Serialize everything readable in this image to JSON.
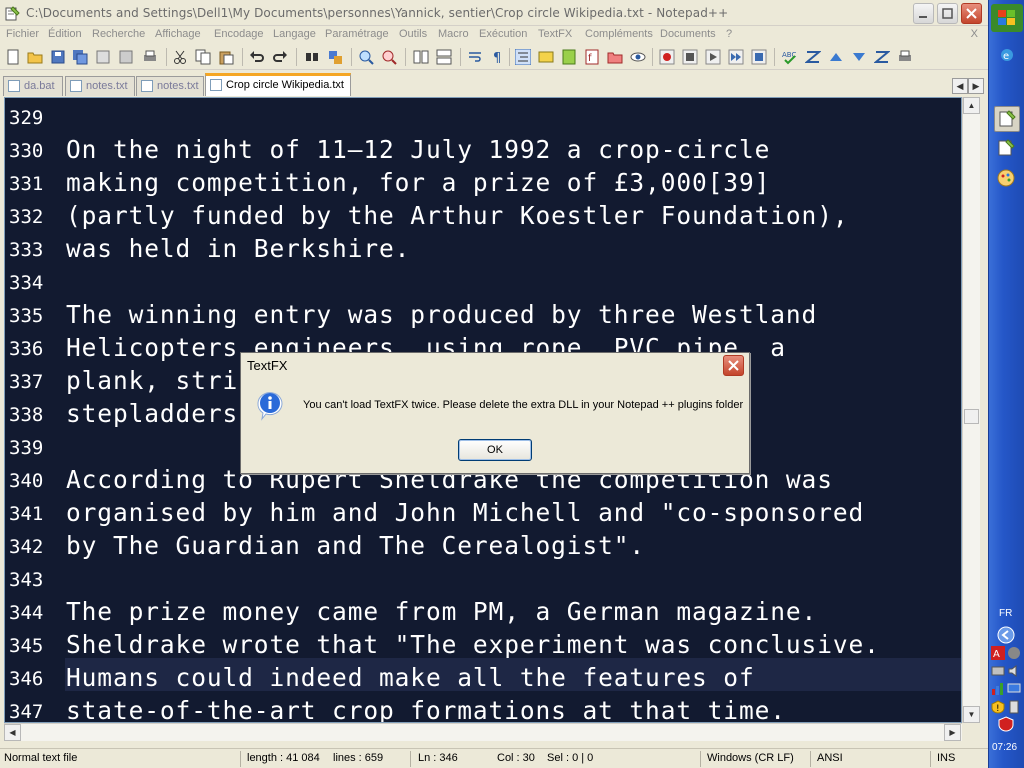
{
  "window": {
    "title": "C:\\Documents and Settings\\Dell1\\My Documents\\personnes\\Yannick, sentier\\Crop circle Wikipedia.txt - Notepad++"
  },
  "menu": {
    "items": [
      "Fichier",
      "Édition",
      "Recherche",
      "Affichage",
      "Encodage",
      "Langage",
      "Paramétrage",
      "Outils",
      "Macro",
      "Exécution",
      "TextFX",
      "Compléments",
      "Documents",
      "?"
    ],
    "close": "X"
  },
  "tabs": [
    {
      "label": "da.bat",
      "active": false
    },
    {
      "label": "notes.txt",
      "active": false
    },
    {
      "label": "notes.txt",
      "active": false
    },
    {
      "label": "Crop circle Wikipedia.txt",
      "active": true
    }
  ],
  "editor": {
    "current_line": 346,
    "lines": [
      {
        "n": "329",
        "text": ""
      },
      {
        "n": "330",
        "text": "On the night of 11–12 July 1992 a crop-circle"
      },
      {
        "n": "331",
        "text": "making competition, for a prize of £3,000[39]"
      },
      {
        "n": "332",
        "text": "(partly funded by the Arthur Koestler Foundation),"
      },
      {
        "n": "333",
        "text": "was held in Berkshire."
      },
      {
        "n": "334",
        "text": ""
      },
      {
        "n": "335",
        "text": "The winning entry was produced by three Westland"
      },
      {
        "n": "336",
        "text": "Helicopters engineers, using rope, PVC pipe, a"
      },
      {
        "n": "337",
        "text": "plank, string, a tape measure, and two"
      },
      {
        "n": "338",
        "text": "stepladders."
      },
      {
        "n": "339",
        "text": ""
      },
      {
        "n": "340",
        "text": "According to Rupert Sheldrake the competition was"
      },
      {
        "n": "341",
        "text": "organised by him and John Michell and \"co-sponsored"
      },
      {
        "n": "342",
        "text": "by The Guardian and The Cerealogist\"."
      },
      {
        "n": "343",
        "text": ""
      },
      {
        "n": "344",
        "text": "The prize money came from PM, a German magazine."
      },
      {
        "n": "345",
        "text": "Sheldrake wrote that \"The experiment was conclusive."
      },
      {
        "n": "346",
        "text": "Humans could indeed make all the features of"
      },
      {
        "n": "347",
        "text": "state-of-the-art crop formations at that time."
      }
    ]
  },
  "statusbar": {
    "file_type": "Normal text file",
    "length": "length : 41 084",
    "lines": "lines : 659",
    "ln": "Ln : 346",
    "col": "Col : 30",
    "sel": "Sel : 0 | 0",
    "eol": "Windows (CR LF)",
    "encoding": "ANSI",
    "mode": "INS"
  },
  "sidebar": {
    "lang": "FR",
    "clock": "07:26"
  },
  "dialog": {
    "title": "TextFX",
    "message": "You can't load TextFX twice. Please delete the extra DLL in your Notepad ++ plugins folder",
    "ok_label": "OK"
  },
  "colors": {
    "editor_bg": "#121a30",
    "editor_text": "#ffffff",
    "current_line_bg": "#1e2745",
    "active_tab_accent": "#f5a623"
  }
}
